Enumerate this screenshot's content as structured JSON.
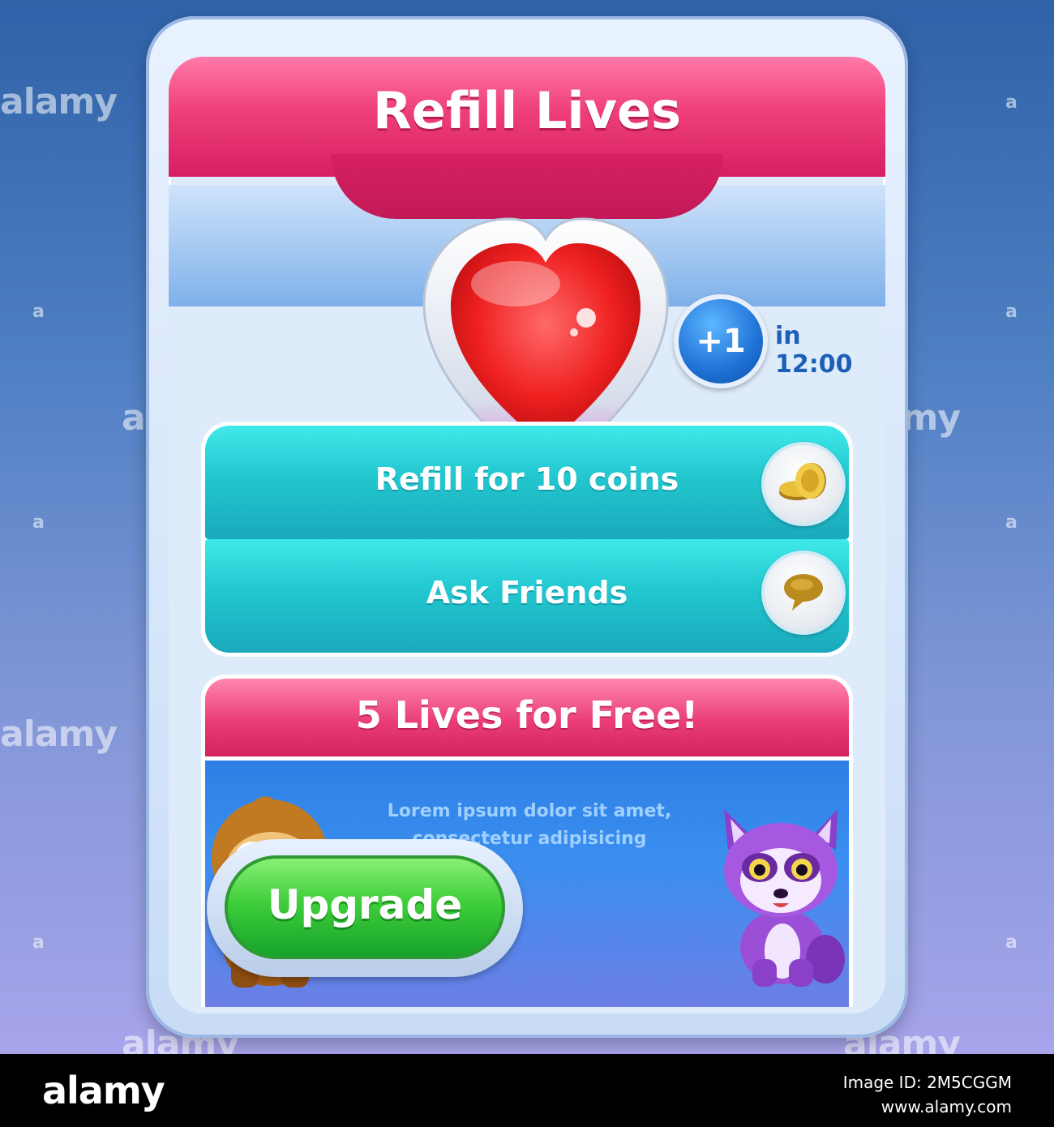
{
  "header": {
    "title": "Refill Lives"
  },
  "timer": {
    "badge": "+1",
    "label": "in 12:00"
  },
  "actions": [
    {
      "label": "Refill for 10 coins",
      "icon": "coins-icon"
    },
    {
      "label": "Ask Friends",
      "icon": "speech-bubble-icon"
    }
  ],
  "promo": {
    "title": "5 Lives for Free!",
    "description_line1": "Lorem ipsum dolor sit amet,",
    "description_line2": "consectetur adipisicing",
    "button_label": "Upgrade"
  },
  "watermark": {
    "text": "alamy",
    "small_text": "a"
  },
  "footer": {
    "logo": "alamy",
    "image_id": "Image ID: 2M5CGGM",
    "site": "www.alamy.com"
  },
  "colors": {
    "pink": "#e83b76",
    "teal": "#22c7cf",
    "blue": "#2f7fe4",
    "green": "#3fce3a"
  }
}
